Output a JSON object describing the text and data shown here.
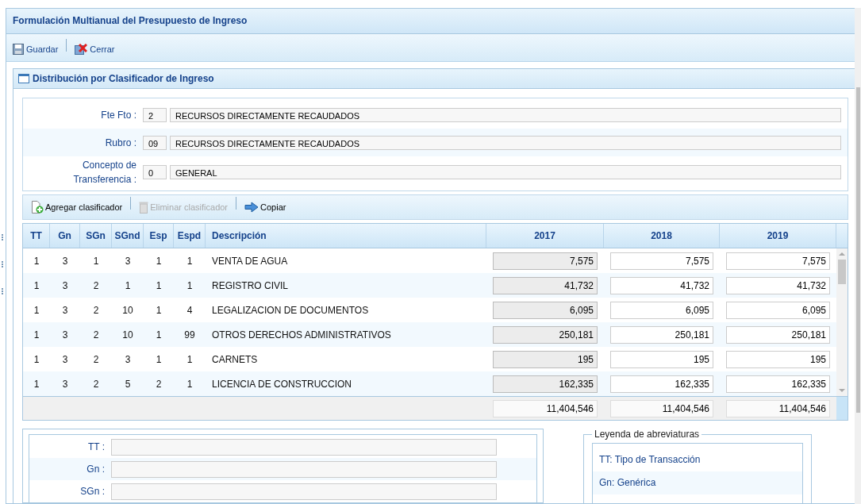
{
  "window": {
    "title": "Formulación Multianual del Presupuesto de Ingreso"
  },
  "toolbar": [
    {
      "label": "Guardar",
      "kind": "save"
    },
    {
      "label": "Cerrar",
      "kind": "close"
    }
  ],
  "panel": {
    "title": "Distribución por Clasificador de Ingreso"
  },
  "header_fields": [
    {
      "label": "Fte Fto :",
      "code": "2",
      "value": "RECURSOS DIRECTAMENTE RECAUDADOS"
    },
    {
      "label": "Rubro :",
      "code": "09",
      "value": "RECURSOS DIRECTAMENTE RECAUDADOS"
    },
    {
      "label": "Concepto de Transferencia :",
      "code": "0",
      "value": "GENERAL"
    }
  ],
  "grid_toolbar": [
    {
      "label": "Agregar clasificador",
      "kind": "add",
      "disabled": false
    },
    {
      "label": "Eliminar clasificador",
      "kind": "delete",
      "disabled": true
    },
    {
      "label": "Copiar",
      "kind": "copy",
      "disabled": false
    }
  ],
  "table": {
    "columns": [
      "TT",
      "Gn",
      "SGn",
      "SGnd",
      "Esp",
      "Espd",
      "Descripción"
    ],
    "year_columns": [
      {
        "label": "2017",
        "editable": false
      },
      {
        "label": "2018",
        "editable": true
      },
      {
        "label": "2019",
        "editable": true
      }
    ],
    "rows": [
      {
        "cells": [
          "1",
          "3",
          "1",
          "3",
          "1",
          "1",
          "VENTA DE AGUA"
        ],
        "amounts": [
          "7,575",
          "7,575",
          "7,575"
        ]
      },
      {
        "cells": [
          "1",
          "3",
          "2",
          "1",
          "1",
          "1",
          "REGISTRO CIVIL"
        ],
        "amounts": [
          "41,732",
          "41,732",
          "41,732"
        ]
      },
      {
        "cells": [
          "1",
          "3",
          "2",
          "10",
          "1",
          "4",
          "LEGALIZACION DE DOCUMENTOS"
        ],
        "amounts": [
          "6,095",
          "6,095",
          "6,095"
        ]
      },
      {
        "cells": [
          "1",
          "3",
          "2",
          "10",
          "1",
          "99",
          "OTROS DERECHOS ADMINISTRATIVOS"
        ],
        "amounts": [
          "250,181",
          "250,181",
          "250,181"
        ]
      },
      {
        "cells": [
          "1",
          "3",
          "2",
          "3",
          "1",
          "1",
          "CARNETS"
        ],
        "amounts": [
          "195",
          "195",
          "195"
        ]
      },
      {
        "cells": [
          "1",
          "3",
          "2",
          "5",
          "2",
          "1",
          "LICENCIA DE CONSTRUCCION"
        ],
        "amounts": [
          "162,335",
          "162,335",
          "162,335"
        ]
      }
    ],
    "totals": [
      "11,404,546",
      "11,404,546",
      "11,404,546"
    ]
  },
  "detail_fields": [
    {
      "label": "TT :"
    },
    {
      "label": "Gn :"
    },
    {
      "label": "SGn :"
    }
  ],
  "legend": {
    "title": "Leyenda de abreviaturas",
    "items": [
      "TT: Tipo de Transacción",
      "Gn: Genérica"
    ]
  }
}
